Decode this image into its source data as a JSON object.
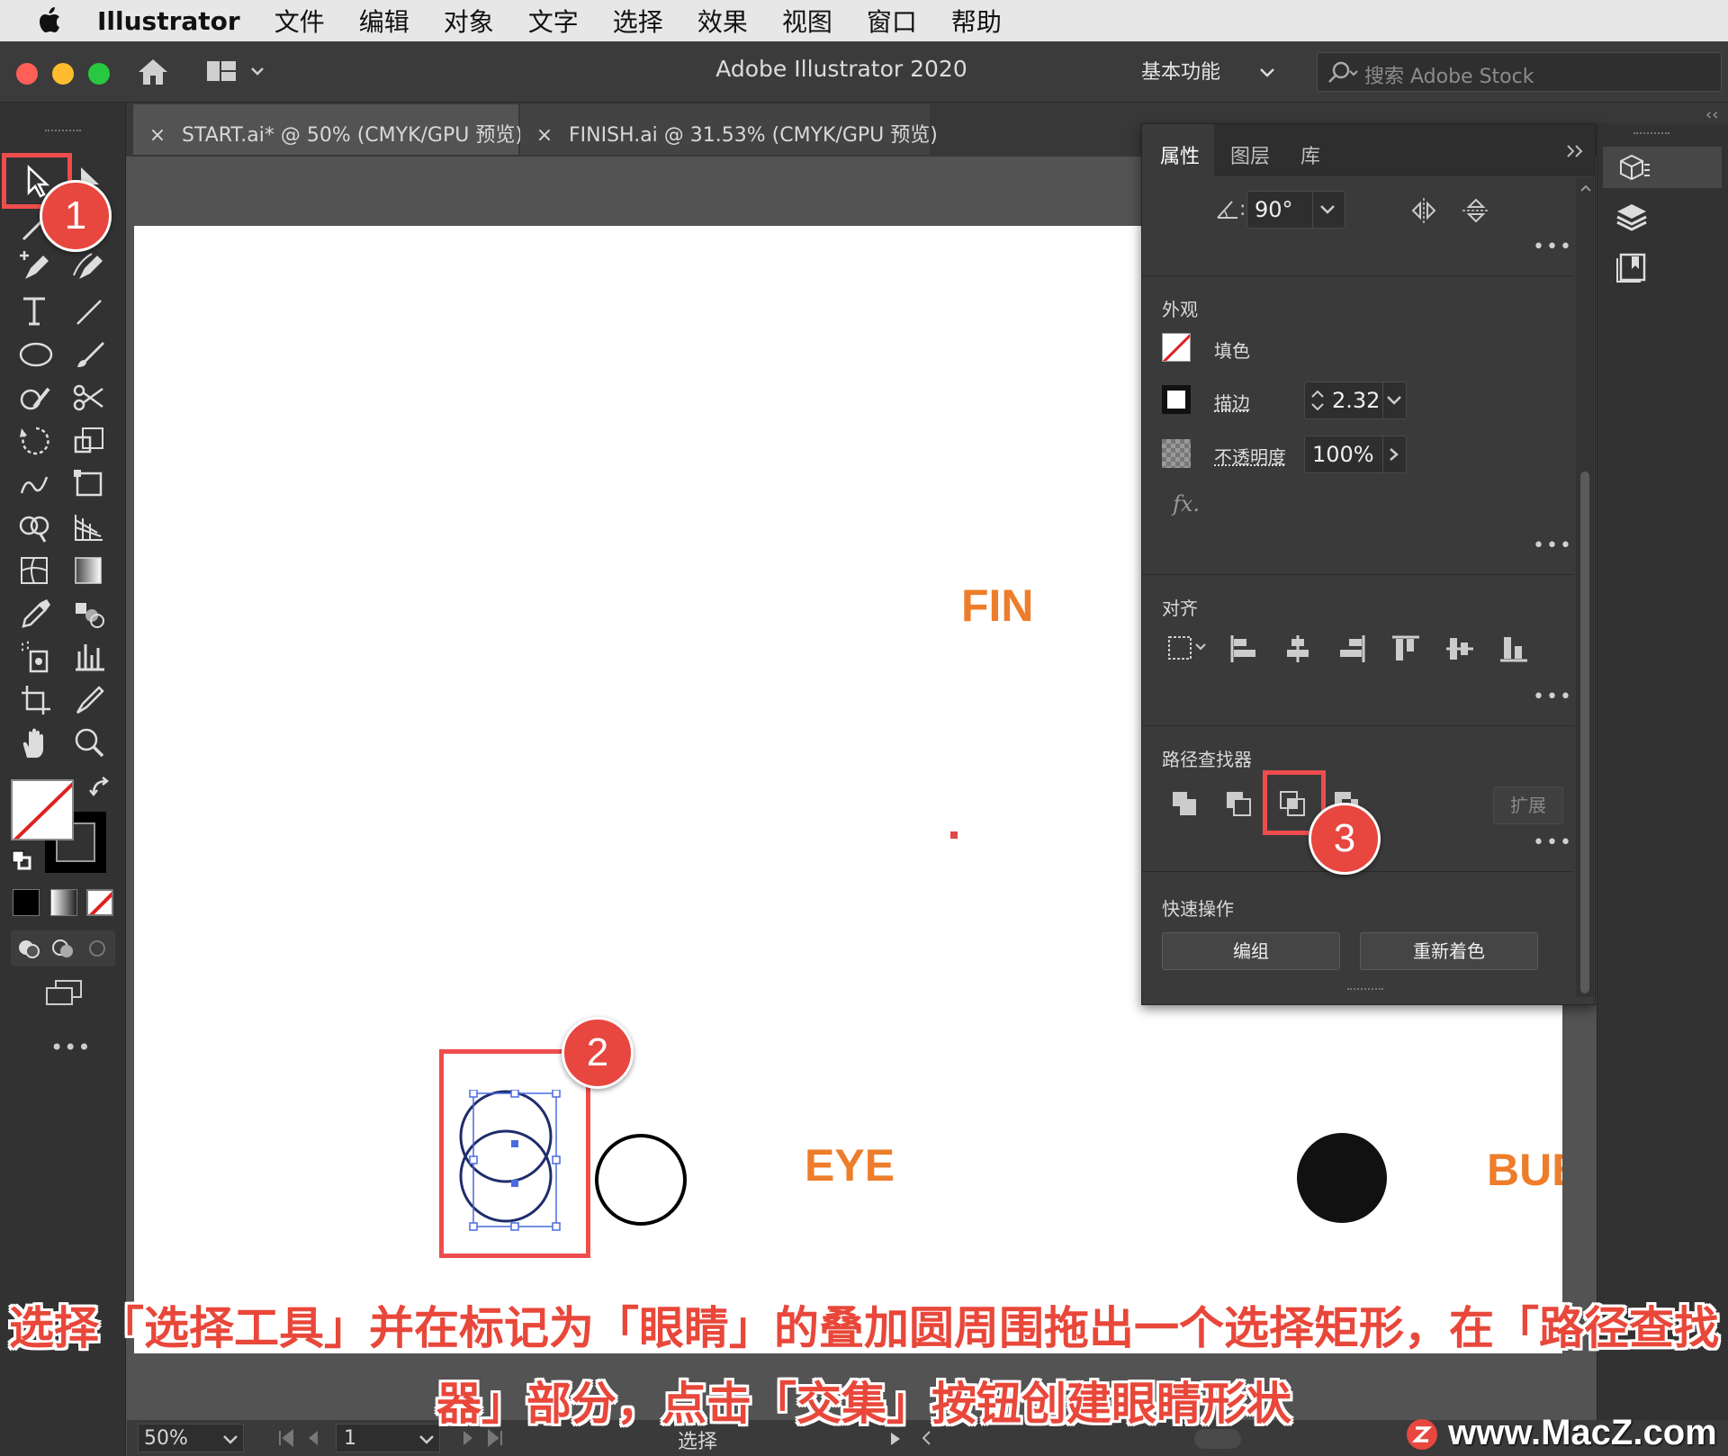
{
  "menubar": {
    "app_name": "Illustrator",
    "items": [
      "文件",
      "编辑",
      "对象",
      "文字",
      "选择",
      "效果",
      "视图",
      "窗口",
      "帮助"
    ]
  },
  "appbar": {
    "title": "Adobe Illustrator 2020",
    "workspace": "基本功能",
    "search_placeholder": "搜索 Adobe Stock",
    "traffic_colors": [
      "#fe5f57",
      "#febc2e",
      "#28c840"
    ]
  },
  "tabs": [
    {
      "label": "START.ai* @ 50% (CMYK/GPU 预览)",
      "close": "×"
    },
    {
      "label": "FINISH.ai @ 31.53% (CMYK/GPU 预览)",
      "close": "×"
    }
  ],
  "canvas": {
    "labels": {
      "fin": "FIN",
      "eye": "EYE",
      "bub": "BUB"
    },
    "accent_color": "#ee7d2b"
  },
  "panel": {
    "tabs": [
      "属性",
      "图层",
      "库"
    ],
    "transform": {
      "angle": "90°"
    },
    "appearance": {
      "title": "外观",
      "fill_label": "填色",
      "stroke_label": "描边",
      "stroke_value": "2.32",
      "opacity_label": "不透明度",
      "opacity_value": "100%",
      "fx": "fx."
    },
    "align": {
      "title": "对齐"
    },
    "pathfinder": {
      "title": "路径查找器",
      "expand_label": "扩展"
    },
    "quick_actions": {
      "title": "快速操作",
      "group_label": "编组",
      "recolor_label": "重新着色"
    },
    "more": "•••"
  },
  "statusbar": {
    "zoom": "50%",
    "artboard_number": "1",
    "tool_name": "选择"
  },
  "callouts": [
    "1",
    "2",
    "3"
  ],
  "caption": {
    "line1": "选择「选择工具」并在标记为「眼睛」的叠加圆周围拖出一个选择矩形，在「路径查找",
    "line2": "器」部分，点击「交集」按钮创建眼睛形状"
  },
  "watermark": "www.MacZ.com",
  "collapse_glyph": "‹‹"
}
